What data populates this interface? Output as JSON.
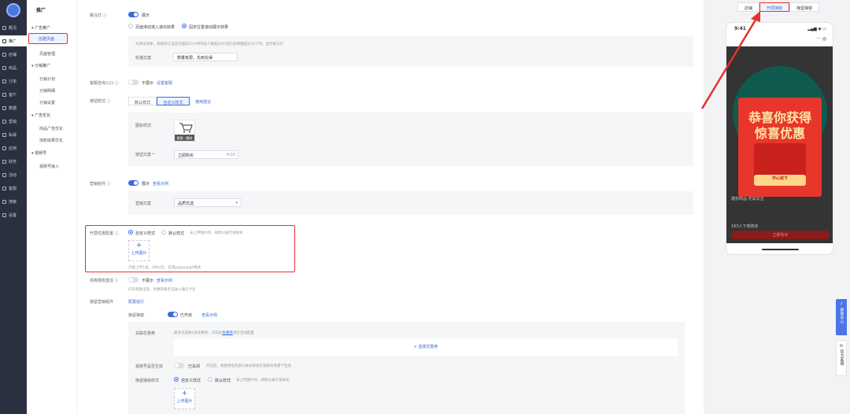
{
  "nav": [
    {
      "label": "概况",
      "icon": "home-icon"
    },
    {
      "label": "推广",
      "icon": "promote-icon"
    },
    {
      "label": "店铺",
      "icon": "store-icon"
    },
    {
      "label": "商品",
      "icon": "goods-icon"
    },
    {
      "label": "订单",
      "icon": "order-icon"
    },
    {
      "label": "客户",
      "icon": "customer-icon"
    },
    {
      "label": "数据",
      "icon": "data-icon"
    },
    {
      "label": "营销",
      "icon": "marketing-icon"
    },
    {
      "label": "私域",
      "icon": "private-icon"
    },
    {
      "label": "应用",
      "icon": "app-icon"
    },
    {
      "label": "财务",
      "icon": "finance-icon"
    },
    {
      "label": "活动",
      "icon": "activity-icon"
    },
    {
      "label": "客服",
      "icon": "service-icon"
    },
    {
      "label": "搜索",
      "icon": "search-icon"
    },
    {
      "label": "设置",
      "icon": "settings-icon"
    }
  ],
  "sub": {
    "title": "推广",
    "g1": "广告推广",
    "g1_items": [
      "创建页面",
      "页面管理"
    ],
    "g2": "分销推广",
    "g2_items": [
      "分销计划",
      "分销明细",
      "分销设置"
    ],
    "g3": "广告优化",
    "g3_items": [
      "商品广告优化",
      "加粉效果优化"
    ],
    "g4": "视频号",
    "g4_items": [
      "视频号接入"
    ]
  },
  "form": {
    "marquee_label": "跑马灯",
    "marquee_state": "展示",
    "marquee_opt1": "页面滑动滚入滚出效果",
    "marquee_opt2": "固定位置滚动展示效果",
    "marquee_hint": "为保证效果，系统默认当该页面近12小时浏览人数超过30且历史销量超过10个时，显示跑马灯",
    "carousel_label": "轮播文案",
    "carousel_value": "数量有限，先到先得",
    "service_label": "客服咨询入口",
    "service_state": "不展示",
    "service_link": "设置客服",
    "button_style_label": "按钮样式",
    "btn_default": "默认样式",
    "btn_custom": "自定义样式",
    "btn_help": "使用建议",
    "icon_label": "图标样式",
    "icon_ops": "更换 · 删除",
    "btn_text_label": "按钮文案",
    "btn_text_value": "立即购买",
    "btn_text_count": "4/10",
    "mkt_label": "营销组件",
    "mkt_state": "展示",
    "mkt_link": "查看示例",
    "mkt_text_label": "营销文案",
    "mkt_text_value": "品质优选",
    "open_label": "开屏优惠配置",
    "open_opt1": "自定义样式",
    "open_opt2": "默认样式",
    "open_hint": "未上传图片时，将默认展示该样式",
    "upload": "上传图片",
    "upload_hint": "只能上传1张，2M以内，支持jpg/png/gif格式",
    "coupon_label": "领券限权激活",
    "coupon_state": "不展示",
    "coupon_link": "查看示例",
    "coupon_hint": "打开券激活后，优惠券将无法放入微信卡包",
    "retain_label": "挽留营销组件",
    "retain_link": "配置指引",
    "popup_label": "挽留弹窗",
    "popup_state": "已开启",
    "popup_link": "查看示例",
    "related_label": "关联优惠券",
    "related_hint": "最多可选择1张优惠券，可前往",
    "related_hint_link": "优惠券",
    "related_hint2": "进行活动配置",
    "select_coupon": "+ 选择优惠券",
    "video_label": "视频号是否生效",
    "video_state": "已关闭",
    "video_hint": "开启后，挽留弹窗及默认样式将会在视频号场景下生效",
    "popup_style_label": "挽留弹窗样式",
    "ps_opt1": "自定义样式",
    "ps_opt2": "默认样式",
    "ps_hint": "未上传图片时，将默认展示该样式"
  },
  "preview": {
    "tabs": [
      "店铺",
      "开屏弹窗",
      "挽留弹窗"
    ],
    "time": "9:41",
    "line1": "恭喜你获得",
    "line2": "惊喜优惠",
    "btn": "开心收下",
    "product": "建材商品-无需关注",
    "sold": "163人下单购买",
    "buy": "立即购买"
  },
  "help": {
    "center": "帮助中心",
    "official": "官方客服"
  },
  "accent": "#3b6bde",
  "annotation_color": "#e5322d"
}
